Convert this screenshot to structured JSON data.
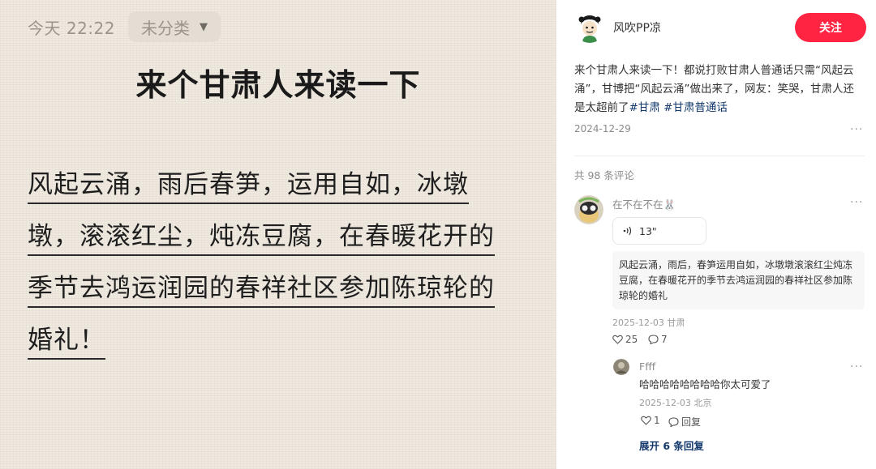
{
  "note_image": {
    "time": "今天 22:22",
    "category": "未分类",
    "title": "来个甘肃人来读一下",
    "body_lines": [
      "风起云涌，雨后春笋，运用自如，冰墩",
      "墩，滚滚红尘，炖冻豆腐，在春暖花开的",
      "季节去鸿运润园的春祥社区参加陈琼轮的",
      "婚礼！"
    ]
  },
  "author": {
    "name": "风吹PP凉",
    "follow_label": "关注"
  },
  "note": {
    "desc": "来个甘肃人来读一下！都说打败甘肃人普通话只需“风起云涌”，甘博把“风起云涌”做出来了，网友：笑哭，甘肃人还是太超前了",
    "tags": [
      "#甘肃",
      "#甘肃普通话"
    ],
    "date": "2024-12-29",
    "more": "···"
  },
  "comments_header": "共 98 条评论",
  "comment": {
    "user": "在不在不在🐰",
    "voice_duration": "13\"",
    "transcript": "风起云涌，雨后，春笋运用自如，冰墩墩滚滚红尘炖冻豆腐，在春暖花开的季节去鸿运润园的春祥社区参加陈琼轮的婚礼",
    "meta": "2025-12-03 甘肃",
    "likes": "25",
    "replies": "7",
    "more": "···"
  },
  "reply": {
    "user": "Ffff",
    "text": "哈哈哈哈哈哈哈哈你太可爱了",
    "meta": "2025-12-03 北京",
    "likes": "1",
    "reply_label": "回复",
    "more": "···"
  },
  "expand_replies": "展开 6 条回复",
  "colors": {
    "accent": "#ff2442",
    "tag": "#13386c",
    "image_bg": "#efe9e0"
  }
}
